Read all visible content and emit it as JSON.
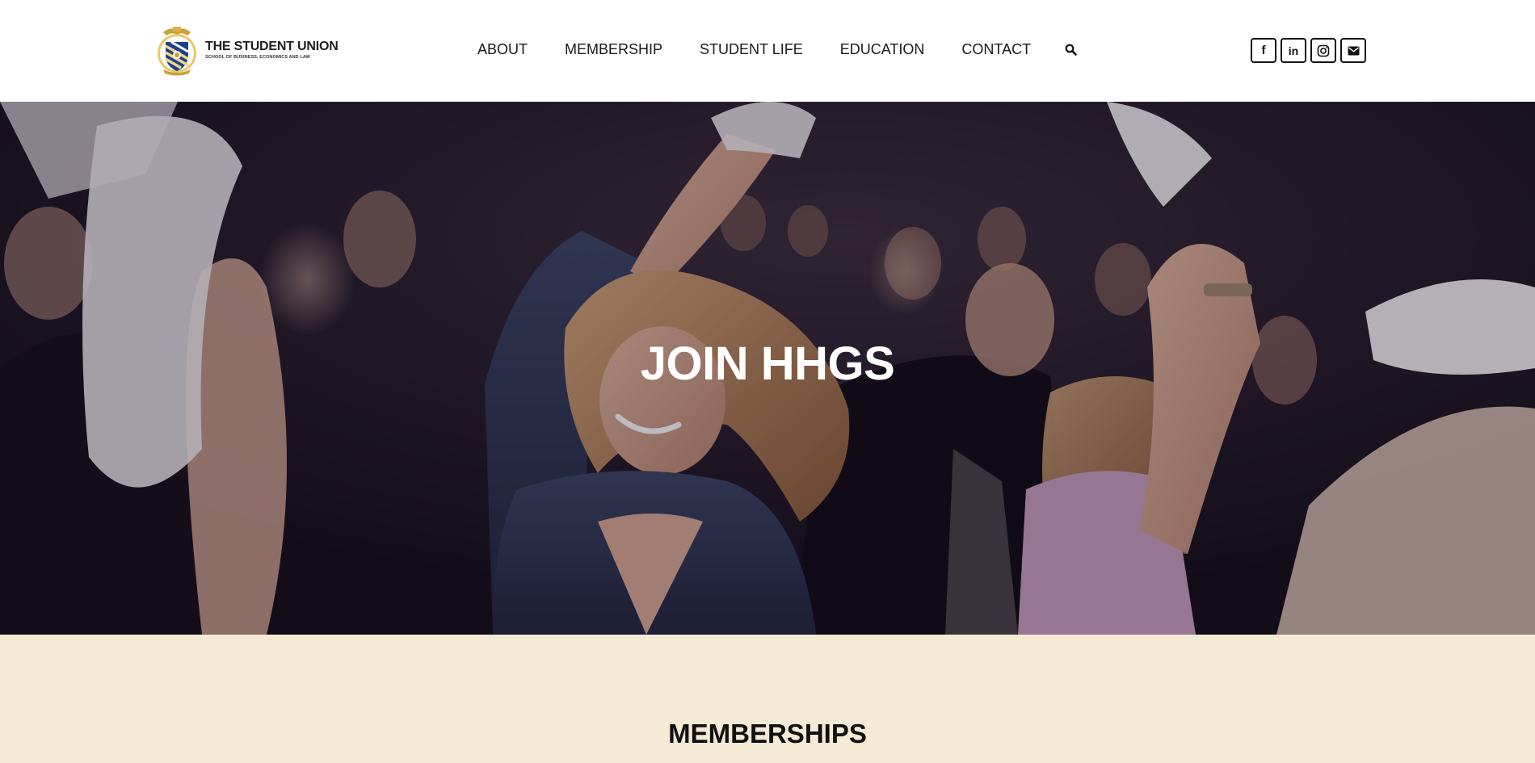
{
  "header": {
    "logo": {
      "title": "THE STUDENT UNION",
      "subtitle": "SCHOOL OF BUSINESS, ECONOMICS AND LAW",
      "emblem_icon": "crest-emblem-icon"
    },
    "nav": [
      {
        "label": "ABOUT"
      },
      {
        "label": "MEMBERSHIP"
      },
      {
        "label": "STUDENT LIFE"
      },
      {
        "label": "EDUCATION"
      },
      {
        "label": "CONTACT"
      }
    ],
    "search_icon": "search-icon",
    "social": [
      {
        "icon": "facebook-icon",
        "glyph": "f"
      },
      {
        "icon": "linkedin-icon",
        "glyph": "in"
      },
      {
        "icon": "instagram-icon",
        "glyph": ""
      },
      {
        "icon": "email-icon",
        "glyph": ""
      }
    ]
  },
  "hero": {
    "title": "JOIN HHGS",
    "image": "party-crowd-photo"
  },
  "memberships": {
    "heading": "MEMBERSHIPS"
  },
  "colors": {
    "header_bg": "#ffffff",
    "section_bg": "#f5ead6",
    "text": "#111111",
    "hero_title": "#ffffff",
    "logo_gold": "#c9a13b",
    "logo_blue": "#1f3f8f"
  }
}
